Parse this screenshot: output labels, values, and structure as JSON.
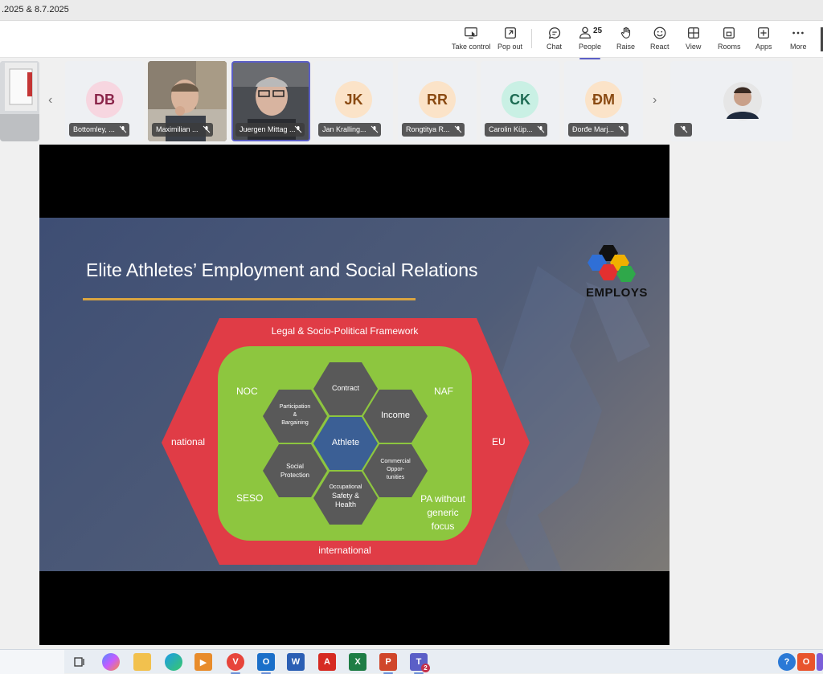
{
  "window": {
    "title": ".2025 & 8.7.2025"
  },
  "toolbar": {
    "take_control": "Take control",
    "pop_out": "Pop out",
    "chat": "Chat",
    "people": "People",
    "people_count": "25",
    "raise": "Raise",
    "react": "React",
    "view": "View",
    "rooms": "Rooms",
    "apps": "Apps",
    "more": "More"
  },
  "participants": [
    {
      "initials": "DB",
      "name": "Bottomley, ...",
      "bg": "#f7d6e0",
      "fg": "#8a2449"
    },
    {
      "initials": "",
      "name": "Maximilian ..."
    },
    {
      "initials": "",
      "name": "Juergen Mittag ..."
    },
    {
      "initials": "JK",
      "name": "Jan Kralling...",
      "bg": "#fbe3c8",
      "fg": "#8a4a12"
    },
    {
      "initials": "RR",
      "name": "Rongtitya R...",
      "bg": "#fbe3c8",
      "fg": "#8a4a12"
    },
    {
      "initials": "CK",
      "name": "Carolin Küp...",
      "bg": "#c9f0e4",
      "fg": "#1d6b53"
    },
    {
      "initials": "ĐM",
      "name": "Đorđe Marj...",
      "bg": "#fbe3c8",
      "fg": "#8a4a12"
    }
  ],
  "slide": {
    "title": "Elite Athletes’ Employment and Social Relations",
    "logo": "EMPLOYS",
    "framework": "Legal & Socio-Political Framework",
    "left": "national",
    "right": "EU",
    "bottom": "international",
    "corners": {
      "noc": "NOC",
      "naf": "NAF",
      "seso": "SESO",
      "pa_line1": "PA without",
      "pa_line2": "generic",
      "pa_line3": "focus"
    },
    "hex": {
      "contract": "Contract",
      "income": "Income",
      "athlete": "Athlete",
      "part1": "Participation",
      "part2": "&",
      "part3": "Bargaining",
      "social1": "Social",
      "social2": "Protection",
      "comm1": "Commercial",
      "comm2": "Oppor-",
      "comm3": "tunities",
      "occ1": "Occupational",
      "occ2": "Safety &",
      "occ3": "Health"
    }
  },
  "taskbar": {
    "teams_badge": "2"
  },
  "colors": {
    "accent": "#5b5fc7",
    "red": "#e03c46",
    "green": "#8dc63f",
    "hex_grey": "#595959",
    "hex_blue": "#3b5f95"
  }
}
